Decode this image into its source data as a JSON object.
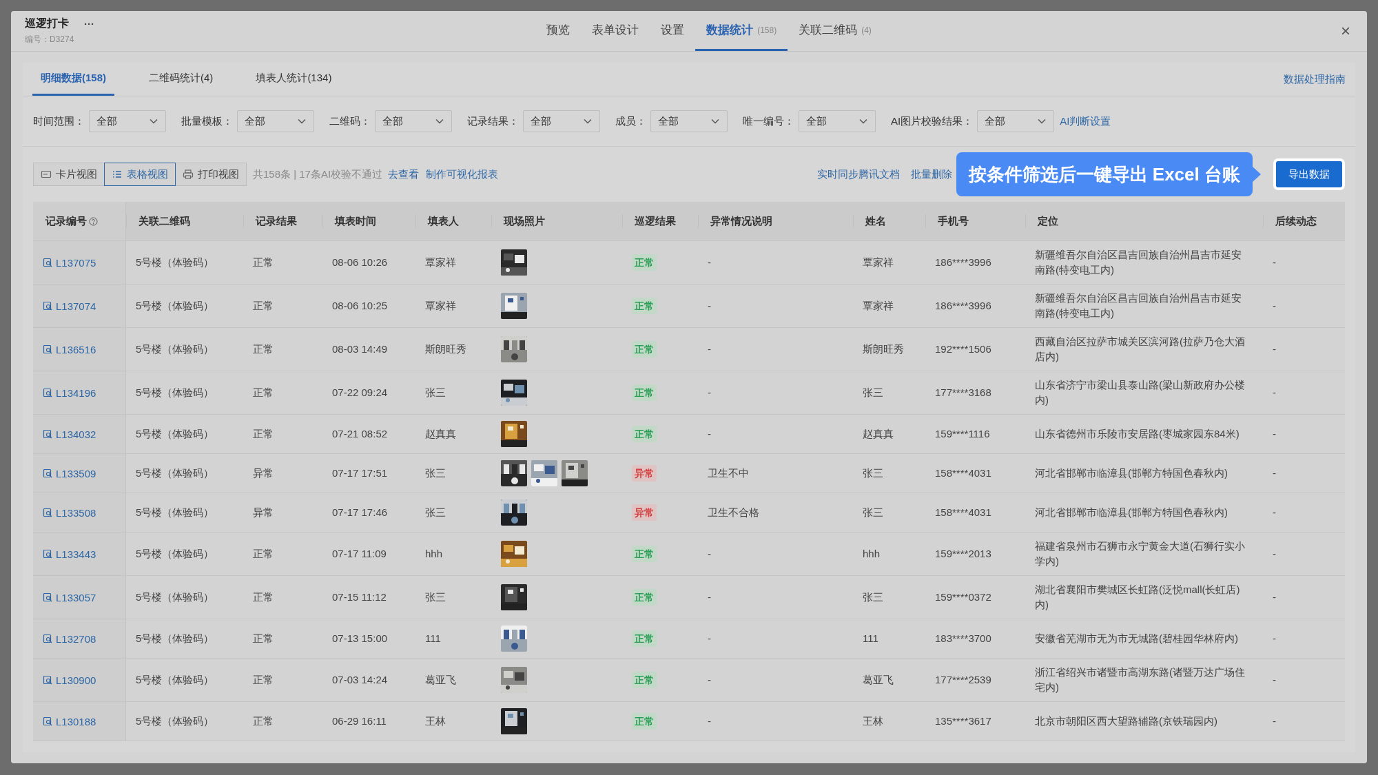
{
  "window": {
    "title": "巡逻打卡",
    "more": "···",
    "code": "编号：D3274",
    "close": "×"
  },
  "nav_tabs": [
    {
      "label": "预览",
      "selected": false
    },
    {
      "label": "表单设计",
      "selected": false
    },
    {
      "label": "设置",
      "selected": false
    },
    {
      "label": "数据统计",
      "count": "(158)",
      "selected": true
    },
    {
      "label": "关联二维码",
      "count": "(4)",
      "selected": false
    }
  ],
  "sub_tabs": [
    {
      "label": "明细数据(158)",
      "selected": true
    },
    {
      "label": "二维码统计(4)",
      "selected": false
    },
    {
      "label": "填表人统计(134)",
      "selected": false
    }
  ],
  "guide_link": "数据处理指南",
  "filters": [
    {
      "label": "时间范围：",
      "value": "全部"
    },
    {
      "label": "批量模板：",
      "value": "全部"
    },
    {
      "label": "二维码：",
      "value": "全部"
    },
    {
      "label": "记录结果：",
      "value": "全部"
    },
    {
      "label": "成员：",
      "value": "全部"
    },
    {
      "label": "唯一编号：",
      "value": "全部"
    },
    {
      "label": "AI图片校验结果：",
      "value": "全部"
    }
  ],
  "ai_settings_link": "AI判断设置",
  "views": [
    {
      "label": "卡片视图",
      "kind": "card",
      "selected": false
    },
    {
      "label": "表格视图",
      "kind": "list",
      "selected": true
    },
    {
      "label": "打印视图",
      "kind": "print",
      "selected": false
    }
  ],
  "summary": "共158条 | 17条AI校验不通过",
  "summary_links": [
    "去查看",
    "制作可视化报表"
  ],
  "actions": [
    "实时同步腾讯文档",
    "批量删除"
  ],
  "callout": "按条件筛选后一键导出 Excel 台账",
  "export_button": "导出数据",
  "table": {
    "columns": [
      "记录编号",
      "关联二维码",
      "记录结果",
      "填表时间",
      "填表人",
      "现场照片",
      "巡逻结果",
      "异常情况说明",
      "姓名",
      "手机号",
      "定位",
      "后续动态"
    ],
    "rows": [
      {
        "id": "L137075",
        "qrcode": "5号楼（体验码）",
        "record_result": "正常",
        "time": "08-06 10:26",
        "filler": "覃家祥",
        "patrol_result": {
          "text": "正常",
          "kind": "normal"
        },
        "note": "-",
        "name": "覃家祥",
        "phone": "186****3996",
        "location": "新疆维吾尔自治区昌吉回族自治州昌吉市延安南路(特变电工内)",
        "follow_up": "-"
      },
      {
        "id": "L137074",
        "qrcode": "5号楼（体验码）",
        "record_result": "正常",
        "time": "08-06 10:25",
        "filler": "覃家祥",
        "patrol_result": {
          "text": "正常",
          "kind": "normal"
        },
        "note": "-",
        "name": "覃家祥",
        "phone": "186****3996",
        "location": "新疆维吾尔自治区昌吉回族自治州昌吉市延安南路(特变电工内)",
        "follow_up": "-"
      },
      {
        "id": "L136516",
        "qrcode": "5号楼（体验码）",
        "record_result": "正常",
        "time": "08-03 14:49",
        "filler": "斯朗旺秀",
        "patrol_result": {
          "text": "正常",
          "kind": "normal"
        },
        "note": "-",
        "name": "斯朗旺秀",
        "phone": "192****1506",
        "location": "西藏自治区拉萨市城关区滨河路(拉萨乃仓大酒店内)",
        "follow_up": "-"
      },
      {
        "id": "L134196",
        "qrcode": "5号楼（体验码）",
        "record_result": "正常",
        "time": "07-22 09:24",
        "filler": "张三",
        "patrol_result": {
          "text": "正常",
          "kind": "normal"
        },
        "note": "-",
        "name": "张三",
        "phone": "177****3168",
        "location": "山东省济宁市梁山县泰山路(梁山新政府办公楼内)",
        "follow_up": "-"
      },
      {
        "id": "L134032",
        "qrcode": "5号楼（体验码）",
        "record_result": "正常",
        "time": "07-21 08:52",
        "filler": "赵真真",
        "patrol_result": {
          "text": "正常",
          "kind": "normal"
        },
        "note": "-",
        "name": "赵真真",
        "phone": "159****1116",
        "location": "山东省德州市乐陵市安居路(枣城家园东84米)",
        "follow_up": "-"
      },
      {
        "id": "L133509",
        "qrcode": "5号楼（体验码）",
        "record_result": "异常",
        "time": "07-17 17:51",
        "filler": "张三",
        "patrol_result": {
          "text": "异常",
          "kind": "abnormal"
        },
        "note": "卫生不中",
        "name": "张三",
        "phone": "158****4031",
        "location": "河北省邯郸市临漳县(邯郸方特国色春秋内)",
        "follow_up": "-"
      },
      {
        "id": "L133508",
        "qrcode": "5号楼（体验码）",
        "record_result": "异常",
        "time": "07-17 17:46",
        "filler": "张三",
        "patrol_result": {
          "text": "异常",
          "kind": "abnormal"
        },
        "note": "卫生不合格",
        "name": "张三",
        "phone": "158****4031",
        "location": "河北省邯郸市临漳县(邯郸方特国色春秋内)",
        "follow_up": "-"
      },
      {
        "id": "L133443",
        "qrcode": "5号楼（体验码）",
        "record_result": "正常",
        "time": "07-17 11:09",
        "filler": "hhh",
        "patrol_result": {
          "text": "正常",
          "kind": "normal"
        },
        "note": "-",
        "name": "hhh",
        "phone": "159****2013",
        "location": "福建省泉州市石狮市永宁黄金大道(石狮行实小学内)",
        "follow_up": "-"
      },
      {
        "id": "L133057",
        "qrcode": "5号楼（体验码）",
        "record_result": "正常",
        "time": "07-15 11:12",
        "filler": "张三",
        "patrol_result": {
          "text": "正常",
          "kind": "normal"
        },
        "note": "-",
        "name": "张三",
        "phone": "159****0372",
        "location": "湖北省襄阳市樊城区长虹路(泛悦mall(长虹店)内)",
        "follow_up": "-"
      },
      {
        "id": "L132708",
        "qrcode": "5号楼（体验码）",
        "record_result": "正常",
        "time": "07-13 15:00",
        "filler": "111",
        "patrol_result": {
          "text": "正常",
          "kind": "normal"
        },
        "note": "-",
        "name": "111",
        "phone": "183****3700",
        "location": "安徽省芜湖市无为市无城路(碧桂园华林府内)",
        "follow_up": "-"
      },
      {
        "id": "L130900",
        "qrcode": "5号楼（体验码）",
        "record_result": "正常",
        "time": "07-03 14:24",
        "filler": "葛亚飞",
        "patrol_result": {
          "text": "正常",
          "kind": "normal"
        },
        "note": "-",
        "name": "葛亚飞",
        "phone": "177****2539",
        "location": "浙江省绍兴市诸暨市高湖东路(诸暨万达广场住宅内)",
        "follow_up": "-"
      },
      {
        "id": "L130188",
        "qrcode": "5号楼（体验码）",
        "record_result": "正常",
        "time": "06-29 16:11",
        "filler": "王林",
        "patrol_result": {
          "text": "正常",
          "kind": "normal"
        },
        "note": "-",
        "name": "王林",
        "phone": "135****3617",
        "location": "北京市朝阳区西大望路辅路(京铁瑞园内)",
        "follow_up": "-"
      }
    ]
  }
}
